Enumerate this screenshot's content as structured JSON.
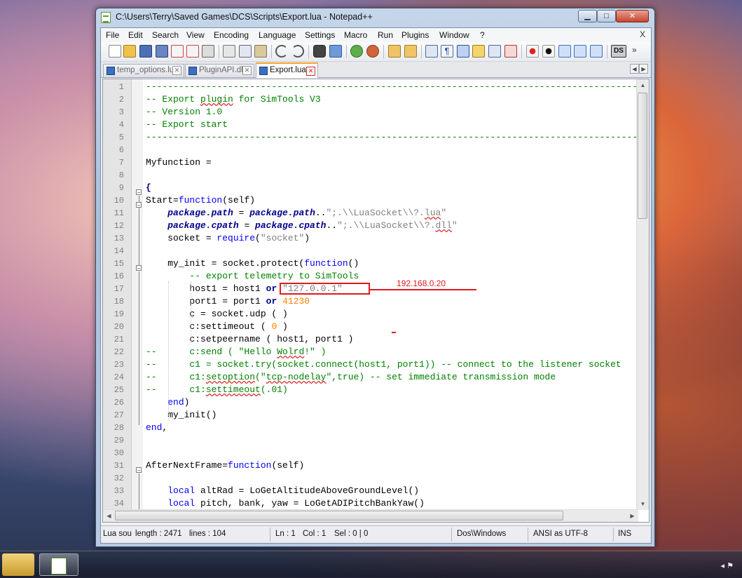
{
  "window": {
    "title": "C:\\Users\\Terry\\Saved Games\\DCS\\Scripts\\Export.lua - Notepad++",
    "minimize_glyph": "▁",
    "maximize_glyph": "□",
    "close_glyph": "✕"
  },
  "menu": {
    "items": [
      "File",
      "Edit",
      "Search",
      "View",
      "Encoding",
      "Language",
      "Settings",
      "Macro",
      "Run",
      "Plugins",
      "Window",
      "?"
    ],
    "close_glyph": "X"
  },
  "toolbar": {
    "icons": [
      "new-file-icon",
      "open-file-icon",
      "save-icon",
      "save-all-icon",
      "close-icon",
      "close-all-icon",
      "print-icon",
      "cut-icon",
      "copy-icon",
      "paste-icon",
      "undo-icon",
      "redo-icon",
      "find-icon",
      "replace-icon",
      "zoom-in-icon",
      "zoom-out-icon",
      "sync-v-icon",
      "sync-h-icon",
      "wrap-icon",
      "all-chars-icon",
      "indent-guide-icon",
      "doc-map-icon",
      "function-list-icon",
      "record-macro-icon",
      "stop-macro-icon",
      "play-macro-icon",
      "run-macro-multiple-icon",
      "save-macro-icon",
      "ds-plugin-icon"
    ],
    "ds_label": "DS",
    "overflow_glyph": "»"
  },
  "tabs": [
    {
      "label": "temp_options.lua",
      "active": false
    },
    {
      "label": "PluginAPI.dll",
      "active": false
    },
    {
      "label": "Export.lua",
      "active": true
    }
  ],
  "editor": {
    "lines": [
      {
        "n": "1",
        "t": [
          [
            "cm",
            "-----------------------------------------------------------------------------------------------------"
          ]
        ]
      },
      {
        "n": "2",
        "t": [
          [
            "cm",
            "-- Export "
          ],
          [
            "cm sq",
            "plugin"
          ],
          [
            "cm",
            " for SimTools V3"
          ]
        ]
      },
      {
        "n": "3",
        "t": [
          [
            "cm",
            "-- Version 1.0"
          ]
        ]
      },
      {
        "n": "4",
        "t": [
          [
            "cm",
            "-- Export start"
          ]
        ]
      },
      {
        "n": "5",
        "t": [
          [
            "cm",
            "-----------------------------------------------------------------------------------------------------"
          ]
        ]
      },
      {
        "n": "6",
        "t": []
      },
      {
        "n": "7",
        "t": [
          [
            "",
            "Myfunction ="
          ]
        ]
      },
      {
        "n": "8",
        "t": []
      },
      {
        "n": "9",
        "t": [
          [
            "op",
            "{"
          ]
        ]
      },
      {
        "n": "10",
        "t": [
          [
            "",
            "Start="
          ],
          [
            "kw",
            "function"
          ],
          [
            "",
            "(self)"
          ]
        ]
      },
      {
        "n": "11",
        "t": [
          [
            "",
            "    "
          ],
          [
            "it",
            "package.path"
          ],
          [
            "",
            " = "
          ],
          [
            "it",
            "package.path"
          ],
          [
            "",
            ".."
          ],
          [
            "st",
            "\";.\\\\LuaSocket\\\\?."
          ],
          [
            "st sq",
            "lua"
          ],
          [
            "st",
            "\""
          ]
        ]
      },
      {
        "n": "12",
        "t": [
          [
            "",
            "    "
          ],
          [
            "it",
            "package.cpath"
          ],
          [
            "",
            " = "
          ],
          [
            "it",
            "package.cpath"
          ],
          [
            "",
            ".."
          ],
          [
            "st",
            "\";.\\\\LuaSocket\\\\?."
          ],
          [
            "st sq",
            "dll"
          ],
          [
            "st",
            "\""
          ]
        ]
      },
      {
        "n": "13",
        "t": [
          [
            "",
            "    socket = "
          ],
          [
            "kw",
            "require"
          ],
          [
            "",
            "("
          ],
          [
            "st",
            "\"socket\""
          ],
          [
            "",
            ")"
          ]
        ]
      },
      {
        "n": "14",
        "t": []
      },
      {
        "n": "15",
        "t": [
          [
            "",
            "    my_init = socket.protect("
          ],
          [
            "kw",
            "function"
          ],
          [
            "",
            "()"
          ]
        ]
      },
      {
        "n": "16",
        "t": [
          [
            "",
            "        "
          ],
          [
            "cm",
            "-- export telemetry to SimTools"
          ]
        ]
      },
      {
        "n": "17",
        "t": [
          [
            "",
            "        host1 = host1 "
          ],
          [
            "kb",
            "or"
          ],
          [
            "",
            " "
          ],
          [
            "st",
            "\"127.0.0.1\""
          ]
        ]
      },
      {
        "n": "18",
        "t": [
          [
            "",
            "        port1 = port1 "
          ],
          [
            "kb",
            "or"
          ],
          [
            "",
            " "
          ],
          [
            "nm",
            "41230"
          ]
        ]
      },
      {
        "n": "19",
        "t": [
          [
            "",
            "        c = socket.udp ( )"
          ]
        ]
      },
      {
        "n": "20",
        "t": [
          [
            "",
            "        c:settimeout ( "
          ],
          [
            "nm",
            "0"
          ],
          [
            "",
            " )"
          ]
        ]
      },
      {
        "n": "21",
        "t": [
          [
            "",
            "        c:setpeername ( host1, port1 )"
          ]
        ]
      },
      {
        "n": "22",
        "t": [
          [
            "cm",
            "--      c:send ( \"Hello "
          ],
          [
            "cm sq",
            "Wolrd"
          ],
          [
            "cm",
            "!\" )"
          ]
        ]
      },
      {
        "n": "23",
        "t": [
          [
            "cm",
            "--      c1 = socket.try(socket.connect(host1, port1)) -- connect to the listener socket"
          ]
        ]
      },
      {
        "n": "24",
        "t": [
          [
            "cm",
            "--      c1:"
          ],
          [
            "cm sq",
            "setoption"
          ],
          [
            "cm",
            "(\""
          ],
          [
            "cm sq",
            "tcp-nodelay"
          ],
          [
            "cm",
            "\",true) -- set immediate transmission mode"
          ]
        ]
      },
      {
        "n": "25",
        "t": [
          [
            "cm",
            "--      c1:"
          ],
          [
            "cm sq",
            "settimeout"
          ],
          [
            "cm",
            "(.01)"
          ]
        ]
      },
      {
        "n": "26",
        "t": [
          [
            "",
            "    "
          ],
          [
            "kw",
            "end"
          ],
          [
            "",
            ")"
          ]
        ]
      },
      {
        "n": "27",
        "t": [
          [
            "",
            "    my_init()"
          ]
        ]
      },
      {
        "n": "28",
        "t": [
          [
            "kw",
            "end"
          ],
          [
            "",
            ","
          ]
        ]
      },
      {
        "n": "29",
        "t": []
      },
      {
        "n": "30",
        "t": []
      },
      {
        "n": "31",
        "t": [
          [
            "",
            "AfterNextFrame="
          ],
          [
            "kw",
            "function"
          ],
          [
            "",
            "(self)"
          ]
        ]
      },
      {
        "n": "32",
        "t": []
      },
      {
        "n": "33",
        "t": [
          [
            "",
            "    "
          ],
          [
            "kw",
            "local"
          ],
          [
            "",
            " altRad = LoGetAltitudeAboveGroundLevel()"
          ]
        ]
      },
      {
        "n": "34",
        "t": [
          [
            "",
            "    "
          ],
          [
            "kw",
            "local"
          ],
          [
            "",
            " pitch, bank, yaw = LoGetADIPitchBankYaw()"
          ]
        ]
      }
    ]
  },
  "statusbar": {
    "language": "Lua sou",
    "length": "length : 2471",
    "lines": "lines : 104",
    "ln": "Ln : 1",
    "col": "Col : 1",
    "sel": "Sel : 0 | 0",
    "eol": "Dos\\Windows",
    "encoding": "ANSI as UTF-8",
    "mode": "INS"
  },
  "annotation": {
    "text": "192.168.0.20",
    "color": "#e0191f"
  },
  "taskbar": {
    "tray_glyph": "◂ ⚑"
  }
}
